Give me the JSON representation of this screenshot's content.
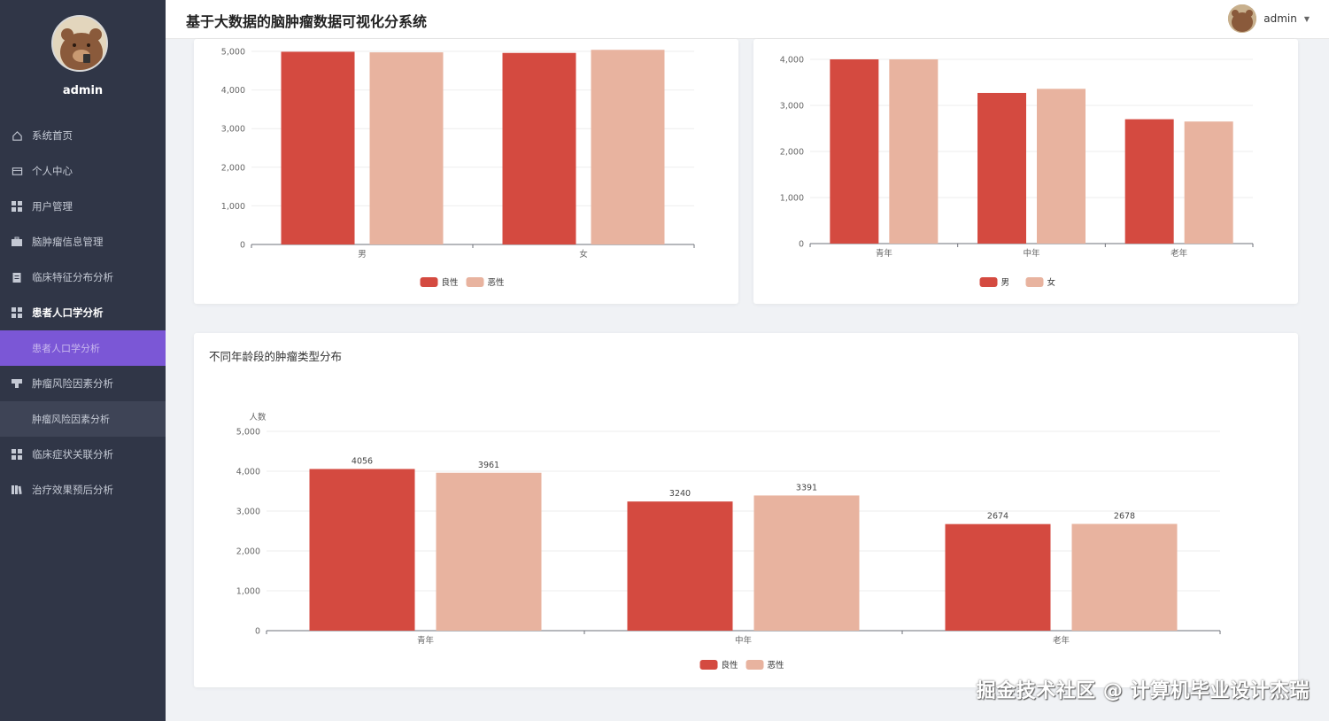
{
  "app": {
    "title": "基于大数据的脑肿瘤数据可视化分系统"
  },
  "user": {
    "name": "admin"
  },
  "sidebar": {
    "username": "admin",
    "items": [
      {
        "label": "系统首页",
        "icon": "home-icon",
        "type": "item"
      },
      {
        "label": "个人中心",
        "icon": "card-icon",
        "type": "item"
      },
      {
        "label": "用户管理",
        "icon": "grid-icon",
        "type": "item"
      },
      {
        "label": "脑肿瘤信息管理",
        "icon": "briefcase-icon",
        "type": "item"
      },
      {
        "label": "临床特征分布分析",
        "icon": "clipboard-icon",
        "type": "item"
      },
      {
        "label": "患者人口学分析",
        "icon": "grid-icon",
        "type": "item",
        "bold": true
      },
      {
        "label": "患者人口学分析",
        "type": "sub",
        "active": true
      },
      {
        "label": "肿瘤风险因素分析",
        "icon": "funnel-icon",
        "type": "item"
      },
      {
        "label": "肿瘤风险因素分析",
        "type": "sub",
        "hover": true
      },
      {
        "label": "临床症状关联分析",
        "icon": "grid-icon",
        "type": "item"
      },
      {
        "label": "治疗效果预后分析",
        "icon": "books-icon",
        "type": "item"
      }
    ]
  },
  "colors": {
    "benign": "#d44a40",
    "malignant": "#e8b39f",
    "sidebar": "#303647",
    "active": "#7b57d6"
  },
  "charts": [
    {
      "id": "chart-gender",
      "title": "",
      "chart_data": {
        "type": "bar",
        "categories": [
          "男",
          "女"
        ],
        "series": [
          {
            "name": "良性",
            "values": [
              4990,
              4960
            ]
          },
          {
            "name": "恶性",
            "values": [
              4975,
              5040
            ]
          }
        ],
        "ylim": [
          0,
          5000
        ],
        "yticks": [
          0,
          1000,
          2000,
          3000,
          4000,
          5000
        ],
        "ytick_labels": [
          "0",
          "1,000",
          "2,000",
          "3,000",
          "4,000",
          "5,000"
        ],
        "legend": "bottom"
      }
    },
    {
      "id": "chart-age-gender",
      "title": "",
      "chart_data": {
        "type": "bar",
        "categories": [
          "青年",
          "中年",
          "老年"
        ],
        "series": [
          {
            "name": "男",
            "values": [
              4000,
              3270,
              2700
            ]
          },
          {
            "name": "女",
            "values": [
              4000,
              3360,
              2650
            ]
          }
        ],
        "ylim": [
          0,
          4000
        ],
        "yticks": [
          0,
          1000,
          2000,
          3000,
          4000
        ],
        "ytick_labels": [
          "0",
          "1,000",
          "2,000",
          "3,000",
          "4,000"
        ],
        "legend": "bottom"
      }
    },
    {
      "id": "chart-age-type",
      "title": "不同年龄段的肿瘤类型分布",
      "chart_data": {
        "type": "bar",
        "categories": [
          "青年",
          "中年",
          "老年"
        ],
        "series": [
          {
            "name": "良性",
            "values": [
              4056,
              3240,
              2674
            ]
          },
          {
            "name": "恶性",
            "values": [
              3961,
              3391,
              2678
            ]
          }
        ],
        "ylabel": "人数",
        "ylim": [
          0,
          5000
        ],
        "yticks": [
          0,
          1000,
          2000,
          3000,
          4000,
          5000
        ],
        "ytick_labels": [
          "0",
          "1,000",
          "2,000",
          "3,000",
          "4,000",
          "5,000"
        ],
        "data_labels": true,
        "legend": "bottom"
      }
    }
  ],
  "watermark": "掘金技术社区 @ 计算机毕业设计杰瑞"
}
